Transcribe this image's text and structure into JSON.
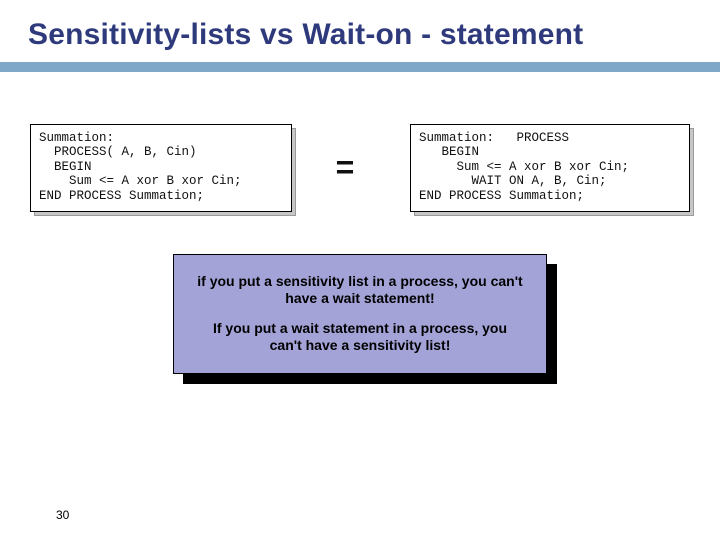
{
  "title": "Sensitivity-lists vs Wait-on - statement",
  "equals": "=",
  "code_left": "Summation:\n  PROCESS( A, B, Cin)\n  BEGIN\n    Sum <= A xor B xor Cin;\nEND PROCESS Summation;",
  "code_right": "Summation:   PROCESS\n   BEGIN\n     Sum <= A xor B xor Cin;\n       WAIT ON A, B, Cin;\nEND PROCESS Summation;",
  "note": {
    "p1": "if you put a sensitivity list in a process, you can't have a wait statement!",
    "p2": "If you put a wait statement in a process, you can't have a sensitivity list!"
  },
  "page_number": "30"
}
